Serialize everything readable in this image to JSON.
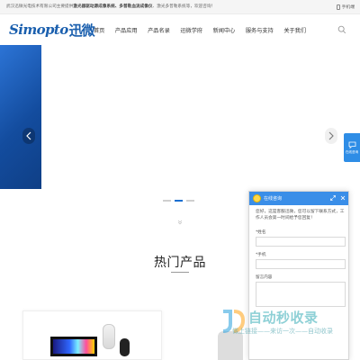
{
  "topbar": {
    "notice_prefix": "武汉迅微光电技术有限公司主要提供",
    "notice_bold": "激光器驱动源成像系统、多普勒血流成像仪",
    "notice_suffix": "、激光多普勒系统等，欢迎咨询！",
    "mobile_label": "手机端"
  },
  "header": {
    "logo_latin": "Simopto",
    "logo_cn": "迅微",
    "nav": [
      "首页",
      "产品应用",
      "产品名录",
      "迅微学府",
      "新闻中心",
      "服务与支持",
      "关于我们"
    ]
  },
  "banner": {
    "prev_icon": "chevron-left-icon",
    "next_icon": "chevron-right-icon",
    "slide_count": 3,
    "active_slide": 2
  },
  "products": {
    "title": "热门产品"
  },
  "float_service": {
    "label": "在线咨询"
  },
  "chat": {
    "title": "在线咨询",
    "greeting": "您好，这是客服迅微，您可以留下联系方式，工作人员会第一时间给予您回复！",
    "name_label": "*姓名",
    "phone_label": "*手机",
    "message_label": "留言内容"
  },
  "watermark": {
    "big": "自动秒收录",
    "small": "做上链接——来访一次——自动收录"
  },
  "colors": {
    "brand_blue": "#1a5fae",
    "chat_header": "#3a8ee8",
    "active_dot": "#1a6fd1"
  }
}
